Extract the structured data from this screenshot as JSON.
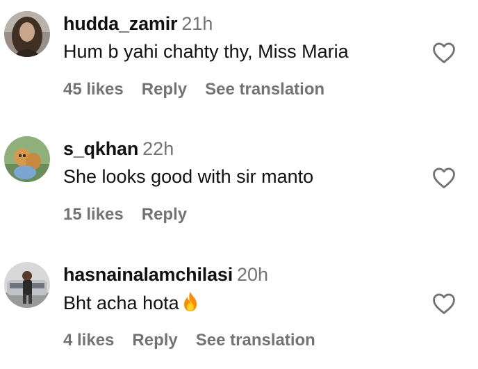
{
  "comments": [
    {
      "username": "hudda_zamir",
      "time": "21h",
      "text": "Hum b yahi chahty thy, Miss Maria",
      "likes": "45 likes",
      "reply": "Reply",
      "translate": "See translation",
      "avatar_icon": "profile-photo-woman-hair"
    },
    {
      "username": "s_qkhan",
      "time": "22h",
      "text": "She looks good with sir manto",
      "likes": "15 likes",
      "reply": "Reply",
      "avatar_icon": "profile-photo-cartoon-squirrels"
    },
    {
      "username": "hasnainalamchilasi",
      "time": "20h",
      "text": "Bht acha hota",
      "emoji": "fire",
      "likes": "4 likes",
      "reply": "Reply",
      "translate": "See translation",
      "avatar_icon": "profile-photo-man-with-car"
    }
  ],
  "icons": {
    "like": "heart-outline-icon"
  },
  "colors": {
    "muted": "#737373",
    "text": "#111111",
    "fire": "#ff8a00"
  }
}
